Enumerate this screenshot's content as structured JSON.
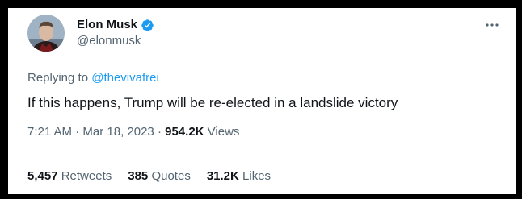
{
  "tweet": {
    "author": {
      "name": "Elon Musk",
      "handle": "@elonmusk",
      "verified": true,
      "avatar_icon": "avatar"
    },
    "replying": {
      "prefix": "Replying to",
      "mention": "@thevivafrei"
    },
    "text": "If this happens, Trump will be re-elected in a landslide victory",
    "meta": {
      "time": "7:21 AM",
      "separator1": "·",
      "date": "Mar 18, 2023",
      "separator2": "·",
      "views_count": "954.2K",
      "views_label": "Views"
    },
    "stats": {
      "retweets_count": "5,457",
      "retweets_label": "Retweets",
      "quotes_count": "385",
      "quotes_label": "Quotes",
      "likes_count": "31.2K",
      "likes_label": "Likes"
    }
  },
  "colors": {
    "text_primary": "#0f1419",
    "text_secondary": "#536471",
    "link": "#1d9bf0",
    "verified": "#1d9bf0",
    "frame": "#000000"
  }
}
